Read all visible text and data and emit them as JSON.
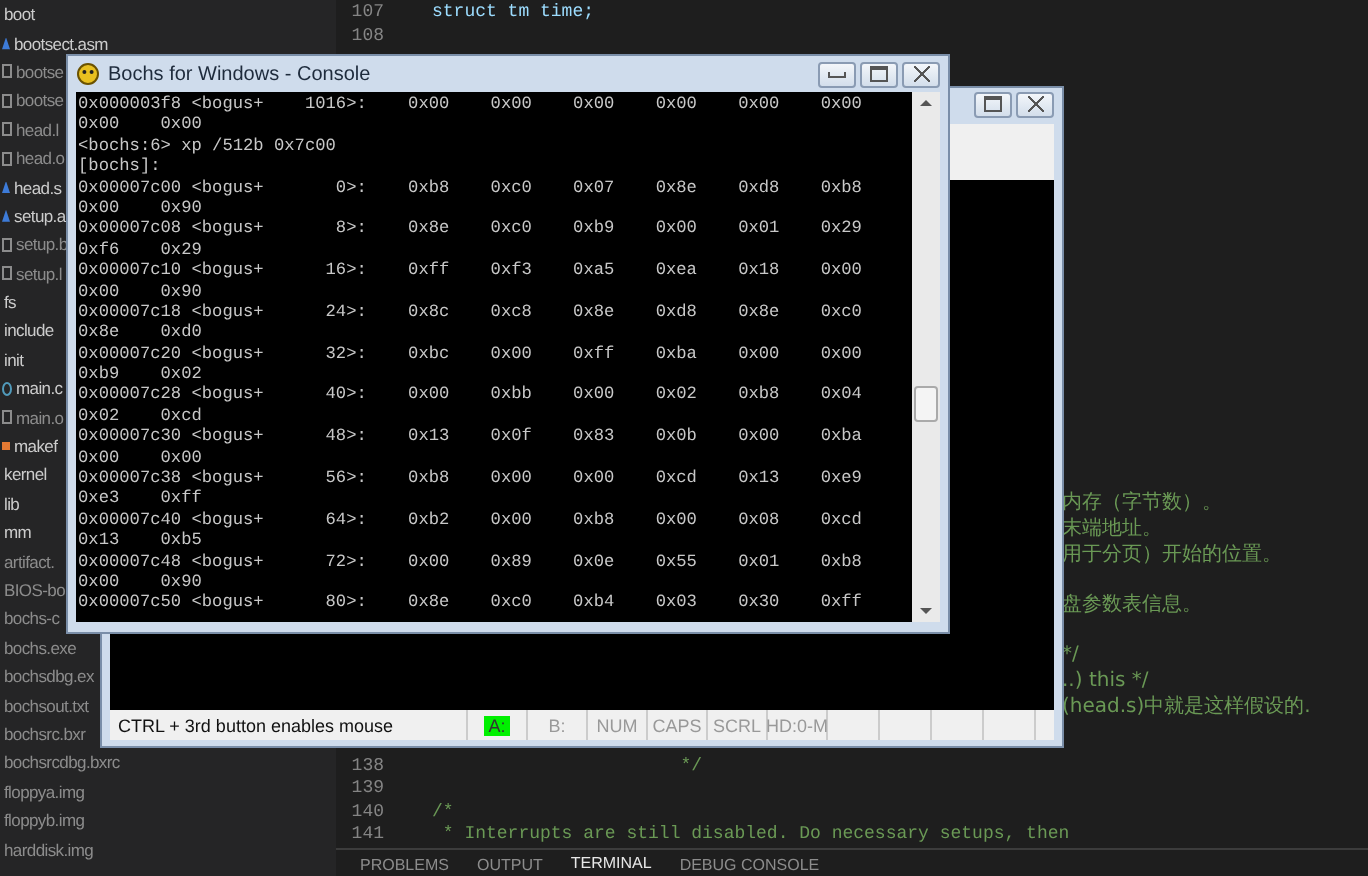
{
  "explorer": {
    "items": [
      {
        "label": "boot",
        "dimmed": false,
        "children": [
          {
            "label": "bootsect.asm",
            "kind": "asm",
            "dimmed": false
          },
          {
            "label": "bootse",
            "kind": "file",
            "dimmed": true
          },
          {
            "label": "bootse",
            "kind": "file",
            "dimmed": true
          },
          {
            "label": "head.l",
            "kind": "file",
            "dimmed": true
          },
          {
            "label": "head.o",
            "kind": "file",
            "dimmed": true
          },
          {
            "label": "head.s",
            "kind": "asm",
            "dimmed": false
          },
          {
            "label": "setup.a",
            "kind": "asm",
            "dimmed": false
          },
          {
            "label": "setup.b",
            "kind": "file",
            "dimmed": true
          },
          {
            "label": "setup.l",
            "kind": "file",
            "dimmed": true
          }
        ]
      },
      {
        "label": "fs",
        "dimmed": false
      },
      {
        "label": "include",
        "dimmed": false
      },
      {
        "label": "init",
        "dimmed": false,
        "children": [
          {
            "label": "main.c",
            "kind": "c",
            "dimmed": false
          },
          {
            "label": "main.o",
            "kind": "file",
            "dimmed": true
          },
          {
            "label": "makef",
            "kind": "make",
            "dimmed": false
          }
        ]
      },
      {
        "label": "kernel",
        "dimmed": false
      },
      {
        "label": "lib",
        "dimmed": false
      },
      {
        "label": "mm",
        "dimmed": false
      },
      {
        "label": "artifact.",
        "dimmed": true
      },
      {
        "label": "BIOS-bo",
        "dimmed": true
      },
      {
        "label": "bochs-c",
        "dimmed": true
      },
      {
        "label": "bochs.exe",
        "dimmed": true
      },
      {
        "label": "bochsdbg.ex",
        "dimmed": true
      },
      {
        "label": "bochsout.txt",
        "dimmed": true
      },
      {
        "label": "bochsrc.bxr",
        "dimmed": true
      },
      {
        "label": "bochsrcdbg.bxrc",
        "dimmed": true
      },
      {
        "label": "floppya.img",
        "dimmed": true
      },
      {
        "label": "floppyb.img",
        "dimmed": true
      },
      {
        "label": "harddisk.img",
        "dimmed": true
      }
    ]
  },
  "editor": {
    "top_lines": [
      {
        "number": "107",
        "code": "struct tm time;"
      },
      {
        "number": "108"
      }
    ],
    "comment_fragments": [
      "内存（字节数）。",
      "末端地址。",
      "用于分页）开始的位置。",
      "盘参数表信息。",
      "*/",
      "..) this */",
      "(head.s)中就是这样假设的."
    ],
    "bottom_lines": [
      {
        "number": "138",
        "code": "                       */"
      },
      {
        "number": "139"
      },
      {
        "number": "140",
        "code": "/*"
      },
      {
        "number": "141",
        "code": " * Interrupts are still disabled. Do necessary setups, then"
      }
    ],
    "panel_tabs": [
      {
        "label": "PROBLEMS",
        "selected": false
      },
      {
        "label": "OUTPUT",
        "selected": false
      },
      {
        "label": "TERMINAL",
        "selected": true
      },
      {
        "label": "DEBUG CONSOLE",
        "selected": false
      }
    ]
  },
  "bochs_window": {
    "status_text": "CTRL + 3rd button enables mouse",
    "status_indicators": [
      {
        "label": "A:",
        "on": true
      },
      {
        "label": "B:",
        "on": false
      },
      {
        "label": "NUM",
        "on": false
      },
      {
        "label": "CAPS",
        "on": false
      },
      {
        "label": "SCRL",
        "on": false
      },
      {
        "label": "HD:0-M",
        "on": false
      }
    ]
  },
  "console_window": {
    "title": "Bochs for Windows - Console",
    "lines": [
      "0x000003f8 <bogus+    1016>:\t0x00\t0x00\t0x00\t0x00\t0x00\t0x00",
      "0x00\t0x00",
      "<bochs:6> xp /512b 0x7c00",
      "[bochs]:",
      "0x00007c00 <bogus+       0>:\t0xb8\t0xc0\t0x07\t0x8e\t0xd8\t0xb8",
      "0x00\t0x90",
      "0x00007c08 <bogus+       8>:\t0x8e\t0xc0\t0xb9\t0x00\t0x01\t0x29",
      "0xf6\t0x29",
      "0x00007c10 <bogus+      16>:\t0xff\t0xf3\t0xa5\t0xea\t0x18\t0x00",
      "0x00\t0x90",
      "0x00007c18 <bogus+      24>:\t0x8c\t0xc8\t0x8e\t0xd8\t0x8e\t0xc0",
      "0x8e\t0xd0",
      "0x00007c20 <bogus+      32>:\t0xbc\t0x00\t0xff\t0xba\t0x00\t0x00",
      "0xb9\t0x02",
      "0x00007c28 <bogus+      40>:\t0x00\t0xbb\t0x00\t0x02\t0xb8\t0x04",
      "0x02\t0xcd",
      "0x00007c30 <bogus+      48>:\t0x13\t0x0f\t0x83\t0x0b\t0x00\t0xba",
      "0x00\t0x00",
      "0x00007c38 <bogus+      56>:\t0xb8\t0x00\t0x00\t0xcd\t0x13\t0xe9",
      "0xe3\t0xff",
      "0x00007c40 <bogus+      64>:\t0xb2\t0x00\t0xb8\t0x00\t0x08\t0xcd",
      "0x13\t0xb5",
      "0x00007c48 <bogus+      72>:\t0x00\t0x89\t0x0e\t0x55\t0x01\t0xb8",
      "0x00\t0x90",
      "0x00007c50 <bogus+      80>:\t0x8e\t0xc0\t0xb4\t0x03\t0x30\t0xff"
    ]
  }
}
